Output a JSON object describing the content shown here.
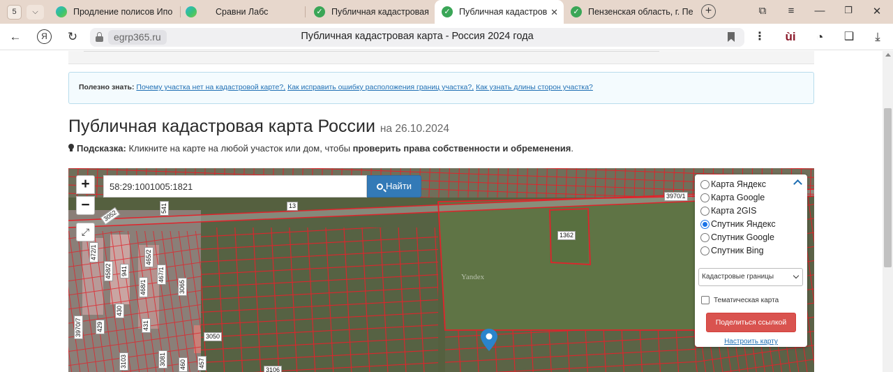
{
  "tabs": {
    "counter": "5",
    "items": [
      {
        "title": "Продление полисов Ипо",
        "icon": "sravni-icon"
      },
      {
        "title": "Сравни Лабс",
        "icon": "sravni-icon"
      },
      {
        "title": "Публичная кадастровая",
        "icon": "check-icon"
      },
      {
        "title": "Публичная кадастров",
        "icon": "check-icon",
        "active": true
      },
      {
        "title": "Пензенская область, г. Пе",
        "icon": "check-icon"
      }
    ]
  },
  "addressbar": {
    "domain": "egrp365.ru",
    "page_title": "Публичная кадастровая карта - Россия 2024 года"
  },
  "info": {
    "label": "Полезно знать:",
    "links": [
      "Почему участка нет на кадастровой карте?,",
      "Как исправить ошибку расположения границ участка?,",
      "Как узнать длины сторон участка?"
    ]
  },
  "heading": {
    "title": "Публичная кадастровая карта России",
    "date": "на 26.10.2024"
  },
  "hint": {
    "label": "Подсказка:",
    "text": "Кликните на карте на любой участок или дом, чтобы",
    "bold": "проверить права собственности и обременения",
    "end": "."
  },
  "map": {
    "search_value": "58:29:1001005:1821",
    "find_label": "Найти",
    "zoom_in": "+",
    "zoom_out": "−",
    "watermark": "Yandex",
    "parcel_labels": [
      "3970/1",
      "1362",
      "13",
      "3052",
      "541",
      "472/1",
      "465/2",
      "467/1",
      "468/1",
      "458/2",
      "941",
      "3065",
      "430",
      "431",
      "3970/7",
      "429",
      "3050",
      "3081",
      "3106",
      "3103",
      "460",
      "457"
    ],
    "layers": [
      {
        "label": "Карта Яндекс",
        "checked": false
      },
      {
        "label": "Карта Google",
        "checked": false
      },
      {
        "label": "Карта 2GIS",
        "checked": false
      },
      {
        "label": "Спутник Яндекс",
        "checked": true
      },
      {
        "label": "Спутник Google",
        "checked": false
      },
      {
        "label": "Спутник Bing",
        "checked": false
      }
    ],
    "overlay_select": "Кадастровые границы",
    "thematic_label": "Тематическая карта",
    "share_label": "Поделиться ссылкой",
    "configure_label": "Настроить карту"
  },
  "colors": {
    "tabbar": "#e7d7cc",
    "parcel_border": "#e0232b",
    "find_button": "#337ab7",
    "share_button": "#d9534f",
    "marker": "#2a84cc"
  }
}
